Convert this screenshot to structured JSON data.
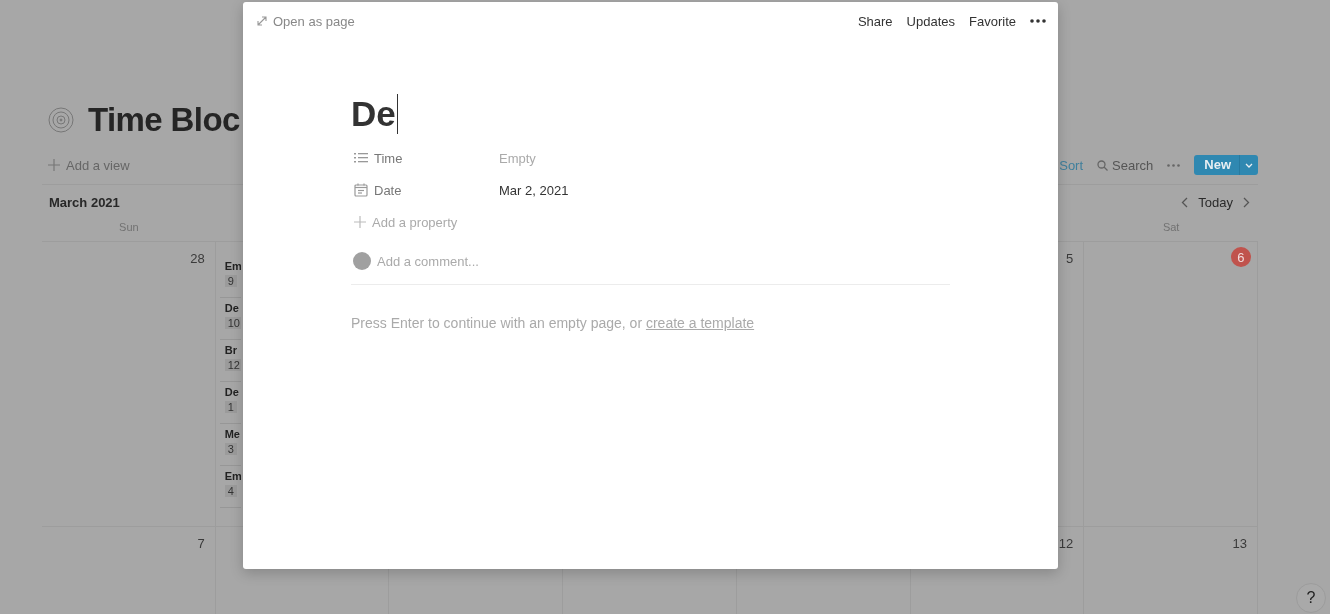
{
  "page": {
    "title": "Time Bloc",
    "add_view": "Add a view"
  },
  "toolbar": {
    "sort": "Sort",
    "search": "Search",
    "new": "New"
  },
  "calendar": {
    "month": "March 2021",
    "today": "Today",
    "columns": [
      {
        "weekday": "Sun",
        "days": [
          {
            "number": "28",
            "today": false
          },
          {
            "number": "7",
            "today": false
          }
        ]
      },
      {
        "days": [
          {
            "events": [
              {
                "title": "Em",
                "time": "9"
              },
              {
                "title": "De",
                "time": "10"
              },
              {
                "title": "Br",
                "time": "12"
              },
              {
                "title": "De",
                "time": "1"
              },
              {
                "title": "Me",
                "time": "3"
              },
              {
                "title": "Em",
                "time": "4"
              }
            ]
          }
        ]
      },
      {},
      {},
      {},
      {
        "days": [
          {
            "number": "5",
            "today": false
          },
          {
            "number": "12",
            "today": false
          }
        ]
      },
      {
        "weekday": "Sat",
        "days": [
          {
            "number": "6",
            "today": true
          },
          {
            "number": "13",
            "today": false
          }
        ]
      }
    ]
  },
  "modal": {
    "open_as_page": "Open as page",
    "actions": [
      "Share",
      "Updates",
      "Favorite"
    ],
    "title": "De",
    "properties": [
      {
        "kind": "list",
        "label": "Time",
        "value": "Empty",
        "empty": true
      },
      {
        "kind": "date",
        "label": "Date",
        "value": "Mar 2, 2021",
        "empty": false
      }
    ],
    "add_property": "Add a property",
    "comment_placeholder": "Add a comment...",
    "hint": "Press Enter to continue with an empty page, or ",
    "hint_link": "create a template"
  },
  "help": "?"
}
